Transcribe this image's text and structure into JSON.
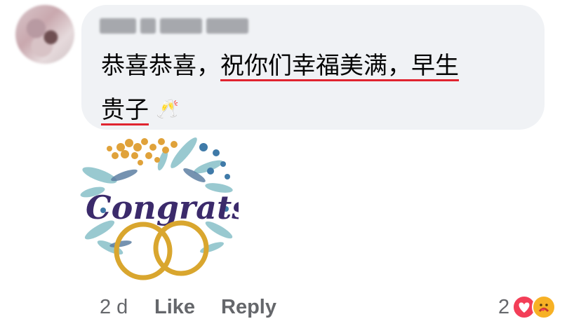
{
  "comment": {
    "author_name": "",
    "text_line1_a": "恭喜恭喜，",
    "text_line1_b": "祝你们幸福美满，早生",
    "text_line2": "贵子",
    "emoji": "🥂"
  },
  "sticker": {
    "word": "Congrats",
    "colors": {
      "text": "#3b2a6b",
      "rings": "#d9a62e",
      "leaves": "#8fc4cc",
      "berries": "#e0a23a"
    }
  },
  "footer": {
    "time": "2 d",
    "like_label": "Like",
    "reply_label": "Reply",
    "reaction_count": "2",
    "reaction_icons": [
      "love-icon",
      "care-icon"
    ]
  },
  "colors": {
    "bubble": "#f0f2f5",
    "secondary_text": "#65676b",
    "spellcheck_underline": "#e0242f"
  }
}
